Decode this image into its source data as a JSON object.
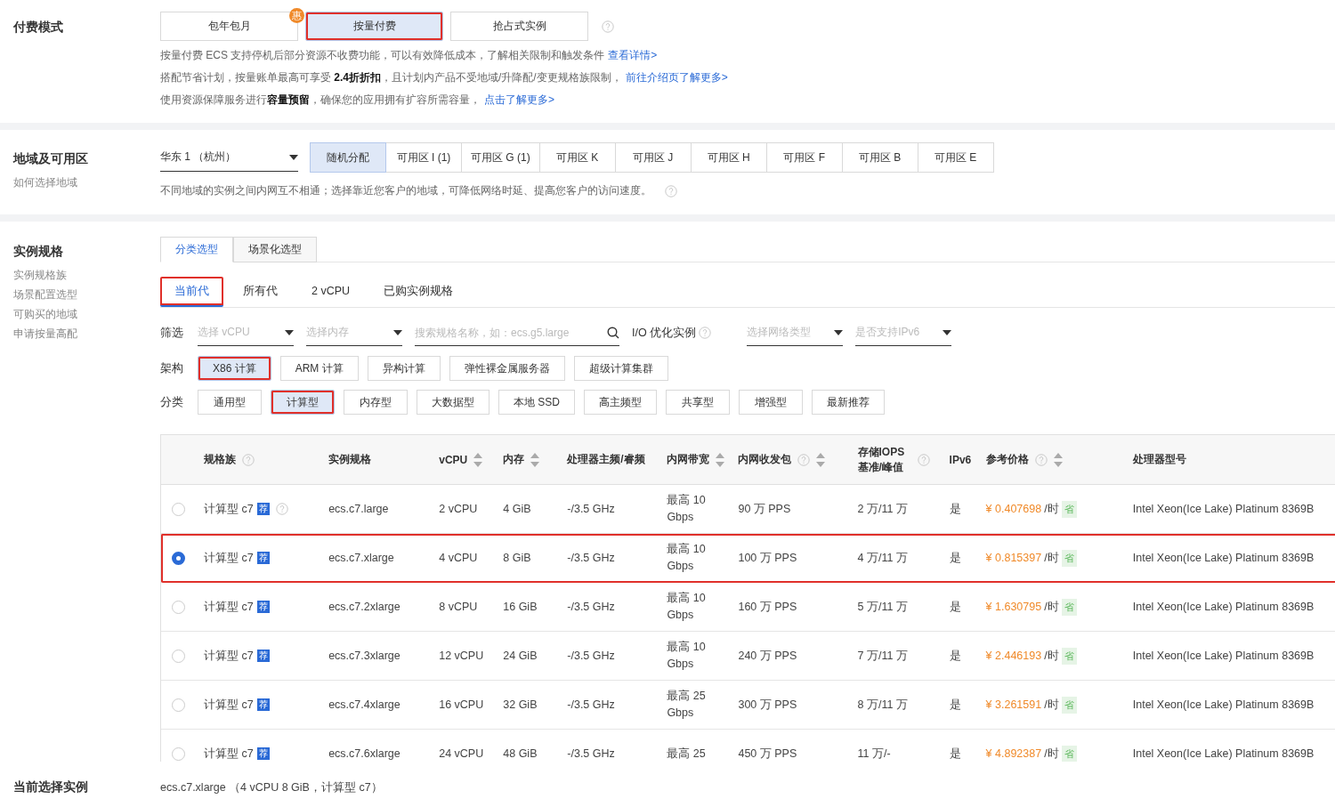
{
  "billing": {
    "label": "付费模式",
    "options": [
      {
        "label": "包年包月",
        "selected": false,
        "annotated": false,
        "badge": "惠"
      },
      {
        "label": "按量付费",
        "selected": true,
        "annotated": true
      },
      {
        "label": "抢占式实例",
        "selected": false,
        "annotated": false
      }
    ],
    "notes": [
      {
        "text": "按量付费 ECS 支持停机后部分资源不收费功能，可以有效降低成本，了解相关限制和触发条件",
        "link": "查看详情>"
      },
      {
        "text": "搭配节省计划，按量账单最高可享受 **2.4折折扣**，且计划内产品不受地域/升降配/变更规格族限制，",
        "link": "前往介绍页了解更多>"
      },
      {
        "text": "使用资源保障服务进行**容量预留**，确保您的应用拥有扩容所需容量，",
        "link": "点击了解更多>"
      }
    ]
  },
  "region": {
    "label": "地域及可用区",
    "help_link": "如何选择地域",
    "region_select": "华东 1 （杭州）",
    "zones": [
      {
        "label": "随机分配",
        "selected": true
      },
      {
        "label": "可用区 I (1)",
        "selected": false
      },
      {
        "label": "可用区 G (1)",
        "selected": false
      },
      {
        "label": "可用区 K",
        "selected": false
      },
      {
        "label": "可用区 J",
        "selected": false
      },
      {
        "label": "可用区 H",
        "selected": false
      },
      {
        "label": "可用区 F",
        "selected": false
      },
      {
        "label": "可用区 B",
        "selected": false
      },
      {
        "label": "可用区 E",
        "selected": false
      }
    ],
    "note": "不同地域的实例之间内网互不相通；选择靠近您客户的地域，可降低网络时延、提高您客户的访问速度。"
  },
  "instance": {
    "label": "实例规格",
    "side_links": [
      "实例规格族",
      "场景配置选型",
      "可购买的地域",
      "申请按量高配"
    ],
    "view_tabs": [
      {
        "label": "分类选型",
        "selected": true
      },
      {
        "label": "场景化选型",
        "selected": false
      }
    ],
    "generation_tabs": [
      {
        "label": "当前代",
        "selected": true,
        "annotated": true
      },
      {
        "label": "所有代",
        "selected": false,
        "annotated": false
      },
      {
        "label": "2 vCPU",
        "selected": false,
        "annotated": false
      },
      {
        "label": "已购实例规格",
        "selected": false,
        "annotated": false
      }
    ],
    "filter_label": "筛选",
    "filters": [
      {
        "kind": "select",
        "placeholder": "选择 vCPU"
      },
      {
        "kind": "select",
        "placeholder": "选择内存"
      },
      {
        "kind": "search",
        "placeholder": "搜索规格名称，如：ecs.g5.large"
      },
      {
        "kind": "label",
        "label": "I/O 优化实例"
      },
      {
        "kind": "select",
        "placeholder": "选择网络类型"
      },
      {
        "kind": "select",
        "placeholder": "是否支持IPv6"
      }
    ],
    "arch_label": "架构",
    "architectures": [
      {
        "label": "X86 计算",
        "selected": true,
        "annotated": true
      },
      {
        "label": "ARM 计算",
        "selected": false,
        "annotated": false
      },
      {
        "label": "异构计算",
        "selected": false,
        "annotated": false
      },
      {
        "label": "弹性裸金属服务器",
        "selected": false,
        "annotated": false
      },
      {
        "label": "超级计算集群",
        "selected": false,
        "annotated": false
      }
    ],
    "category_label": "分类",
    "categories": [
      {
        "label": "通用型",
        "selected": false,
        "annotated": false
      },
      {
        "label": "计算型",
        "selected": true,
        "annotated": true
      },
      {
        "label": "内存型",
        "selected": false,
        "annotated": false
      },
      {
        "label": "大数据型",
        "selected": false,
        "annotated": false
      },
      {
        "label": "本地 SSD",
        "selected": false,
        "annotated": false
      },
      {
        "label": "高主频型",
        "selected": false,
        "annotated": false
      },
      {
        "label": "共享型",
        "selected": false,
        "annotated": false
      },
      {
        "label": "增强型",
        "selected": false,
        "annotated": false
      },
      {
        "label": "最新推荐",
        "selected": false,
        "annotated": false
      }
    ],
    "table": {
      "columns": [
        {
          "label": "规格族",
          "help": true,
          "sortable": false
        },
        {
          "label": "实例规格",
          "help": false,
          "sortable": false
        },
        {
          "label": "vCPU",
          "help": false,
          "sortable": true
        },
        {
          "label": "内存",
          "help": false,
          "sortable": true
        },
        {
          "label": "处理器主频/睿频",
          "help": false,
          "sortable": false
        },
        {
          "label": "内网带宽",
          "help": false,
          "sortable": true
        },
        {
          "label": "内网收发包",
          "help": true,
          "sortable": true
        },
        {
          "label": "存储IOPS 基准/峰值",
          "help": true,
          "sortable": false
        },
        {
          "label": "IPv6",
          "help": false,
          "sortable": false
        },
        {
          "label": "参考价格",
          "help": true,
          "sortable": true
        },
        {
          "label": "处理器型号",
          "help": false,
          "sortable": false
        }
      ],
      "rows": [
        {
          "selected": false,
          "annotated": false,
          "family": "计算型 c7",
          "badge": "荐",
          "family_help": true,
          "spec": "ecs.c7.large",
          "vcpu": "2 vCPU",
          "memory": "4 GiB",
          "clock": "-/3.5 GHz",
          "bandwidth": [
            "最高 10",
            "Gbps"
          ],
          "pps": "90 万 PPS",
          "iops": "2 万/11 万",
          "ipv6": "是",
          "currency": "¥",
          "price": "0.407698",
          "unit": "/时",
          "save": "省",
          "cpu": "Intel Xeon(Ice Lake) Platinum 8369B"
        },
        {
          "selected": true,
          "annotated": true,
          "family": "计算型 c7",
          "badge": "荐",
          "family_help": false,
          "spec": "ecs.c7.xlarge",
          "vcpu": "4 vCPU",
          "memory": "8 GiB",
          "clock": "-/3.5 GHz",
          "bandwidth": [
            "最高 10",
            "Gbps"
          ],
          "pps": "100 万 PPS",
          "iops": "4 万/11 万",
          "ipv6": "是",
          "currency": "¥",
          "price": "0.815397",
          "unit": "/时",
          "save": "省",
          "cpu": "Intel Xeon(Ice Lake) Platinum 8369B"
        },
        {
          "selected": false,
          "annotated": false,
          "family": "计算型 c7",
          "badge": "荐",
          "family_help": false,
          "spec": "ecs.c7.2xlarge",
          "vcpu": "8 vCPU",
          "memory": "16 GiB",
          "clock": "-/3.5 GHz",
          "bandwidth": [
            "最高 10",
            "Gbps"
          ],
          "pps": "160 万 PPS",
          "iops": "5 万/11 万",
          "ipv6": "是",
          "currency": "¥",
          "price": "1.630795",
          "unit": "/时",
          "save": "省",
          "cpu": "Intel Xeon(Ice Lake) Platinum 8369B"
        },
        {
          "selected": false,
          "annotated": false,
          "family": "计算型 c7",
          "badge": "荐",
          "family_help": false,
          "spec": "ecs.c7.3xlarge",
          "vcpu": "12 vCPU",
          "memory": "24 GiB",
          "clock": "-/3.5 GHz",
          "bandwidth": [
            "最高 10",
            "Gbps"
          ],
          "pps": "240 万 PPS",
          "iops": "7 万/11 万",
          "ipv6": "是",
          "currency": "¥",
          "price": "2.446193",
          "unit": "/时",
          "save": "省",
          "cpu": "Intel Xeon(Ice Lake) Platinum 8369B"
        },
        {
          "selected": false,
          "annotated": false,
          "family": "计算型 c7",
          "badge": "荐",
          "family_help": false,
          "spec": "ecs.c7.4xlarge",
          "vcpu": "16 vCPU",
          "memory": "32 GiB",
          "clock": "-/3.5 GHz",
          "bandwidth": [
            "最高 25",
            "Gbps"
          ],
          "pps": "300 万 PPS",
          "iops": "8 万/11 万",
          "ipv6": "是",
          "currency": "¥",
          "price": "3.261591",
          "unit": "/时",
          "save": "省",
          "cpu": "Intel Xeon(Ice Lake) Platinum 8369B"
        },
        {
          "selected": false,
          "annotated": false,
          "family": "计算型 c7",
          "badge": "荐",
          "family_help": false,
          "spec": "ecs.c7.6xlarge",
          "vcpu": "24 vCPU",
          "memory": "48 GiB",
          "clock": "-/3.5 GHz",
          "bandwidth": [
            "最高 25"
          ],
          "pps": "450 万 PPS",
          "iops": "11 万/-",
          "ipv6": "是",
          "currency": "¥",
          "price": "4.892387",
          "unit": "/时",
          "save": "省",
          "cpu": "Intel Xeon(Ice Lake) Platinum 8369B"
        }
      ]
    }
  },
  "current": {
    "label": "当前选择实例",
    "value": "ecs.c7.xlarge （4 vCPU 8 GiB，计算型 c7）"
  }
}
